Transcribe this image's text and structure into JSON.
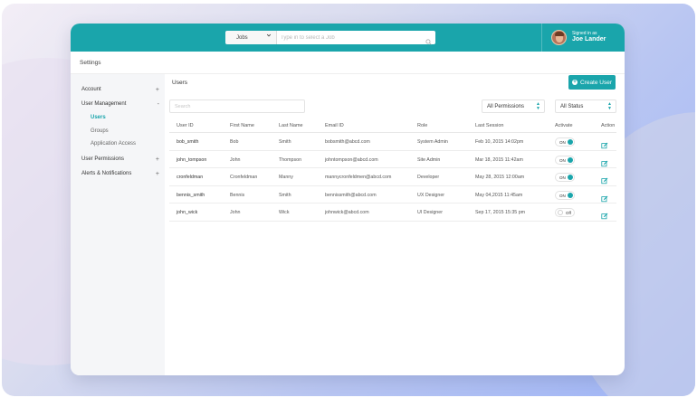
{
  "header": {
    "jobs_select": "Jobs",
    "search_placeholder": "Type in to select a Job",
    "signed_in_as": "Signed in as",
    "user_name": "Joe Lander"
  },
  "page_title": "Settings",
  "sidebar": {
    "items": [
      {
        "label": "Account",
        "toggle": "+"
      },
      {
        "label": "User Management",
        "toggle": "-"
      },
      {
        "label": "User Permissions",
        "toggle": "+"
      },
      {
        "label": "Alerts & Notifications",
        "toggle": "+"
      }
    ],
    "sub_items": [
      {
        "label": "Users",
        "active": true
      },
      {
        "label": "Groups",
        "active": false
      },
      {
        "label": "Application Access",
        "active": false
      }
    ]
  },
  "main": {
    "title": "Users",
    "create_button": "Create User",
    "search_placeholder": "Search",
    "filter_permissions": "All Permissions",
    "filter_status": "All Status"
  },
  "table": {
    "columns": [
      "User ID",
      "First Name",
      "Last Name",
      "Email ID",
      "Role",
      "Last Session",
      "Activate",
      "Action"
    ],
    "rows": [
      {
        "user_id": "bob_smith",
        "first": "Bob",
        "last": "Smith",
        "email": "bobsmith@abcd.com",
        "role": "System Admin",
        "session": "Feb 10, 2015 14:02pm",
        "active": true,
        "toggle_label": "ON"
      },
      {
        "user_id": "john_tompson",
        "first": "John",
        "last": "Thompson",
        "email": "johntompson@abcd.com",
        "role": "Site Admin",
        "session": "Mar 18, 2015 11:42am",
        "active": true,
        "toggle_label": "ON"
      },
      {
        "user_id": "cronfeldman",
        "first": "Cronfeldman",
        "last": "Manny",
        "email": "mannycronfeldmen@abcd.com",
        "role": "Developer",
        "session": "May 28, 2015 12:00am",
        "active": true,
        "toggle_label": "ON"
      },
      {
        "user_id": "bennis_smith",
        "first": "Bennis",
        "last": "Smith",
        "email": "bennissmith@abcd.com",
        "role": "UX Designer",
        "session": "May 04,2015 11:45am",
        "active": true,
        "toggle_label": "ON"
      },
      {
        "user_id": "john_wick",
        "first": "John",
        "last": "Wick",
        "email": "johnwick@abcd.com",
        "role": "UI Designer",
        "session": "Sep 17, 2015 15:35 pm",
        "active": false,
        "toggle_label": "Off"
      }
    ]
  },
  "colors": {
    "accent": "#1aa5ab",
    "sidebar_bg": "#f5f6f8"
  },
  "icons": {
    "search": "search-icon",
    "chevron": "chevron-down-icon",
    "edit": "edit-icon",
    "plus": "plus-circle-icon"
  }
}
